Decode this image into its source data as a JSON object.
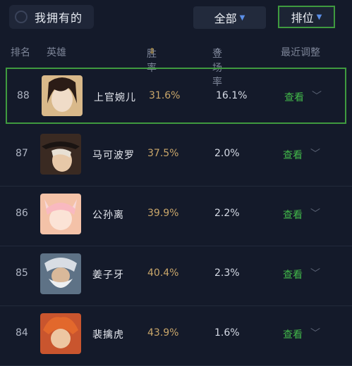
{
  "topbar": {
    "owned_label": "我拥有的",
    "filter_all_label": "全部",
    "filter_rank_label": "排位"
  },
  "columns": {
    "rank": "排名",
    "hero": "英雄",
    "winrate": "胜率",
    "pickrate": "登场率",
    "recent": "最近调整"
  },
  "rows": [
    {
      "rank": "88",
      "name": "上官婉儿",
      "winrate": "31.6%",
      "pickrate": "16.1%",
      "action": "查看"
    },
    {
      "rank": "87",
      "name": "马可波罗",
      "winrate": "37.5%",
      "pickrate": "2.0%",
      "action": "查看"
    },
    {
      "rank": "86",
      "name": "公孙离",
      "winrate": "39.9%",
      "pickrate": "2.2%",
      "action": "查看"
    },
    {
      "rank": "85",
      "name": "姜子牙",
      "winrate": "40.4%",
      "pickrate": "2.3%",
      "action": "查看"
    },
    {
      "rank": "84",
      "name": "裴擒虎",
      "winrate": "43.9%",
      "pickrate": "1.6%",
      "action": "查看"
    }
  ],
  "colors": {
    "background": "#141a2a",
    "accent_green": "#42b84a",
    "winrate_gold": "#c9a66a",
    "highlight_border": "#3f9a3f"
  }
}
